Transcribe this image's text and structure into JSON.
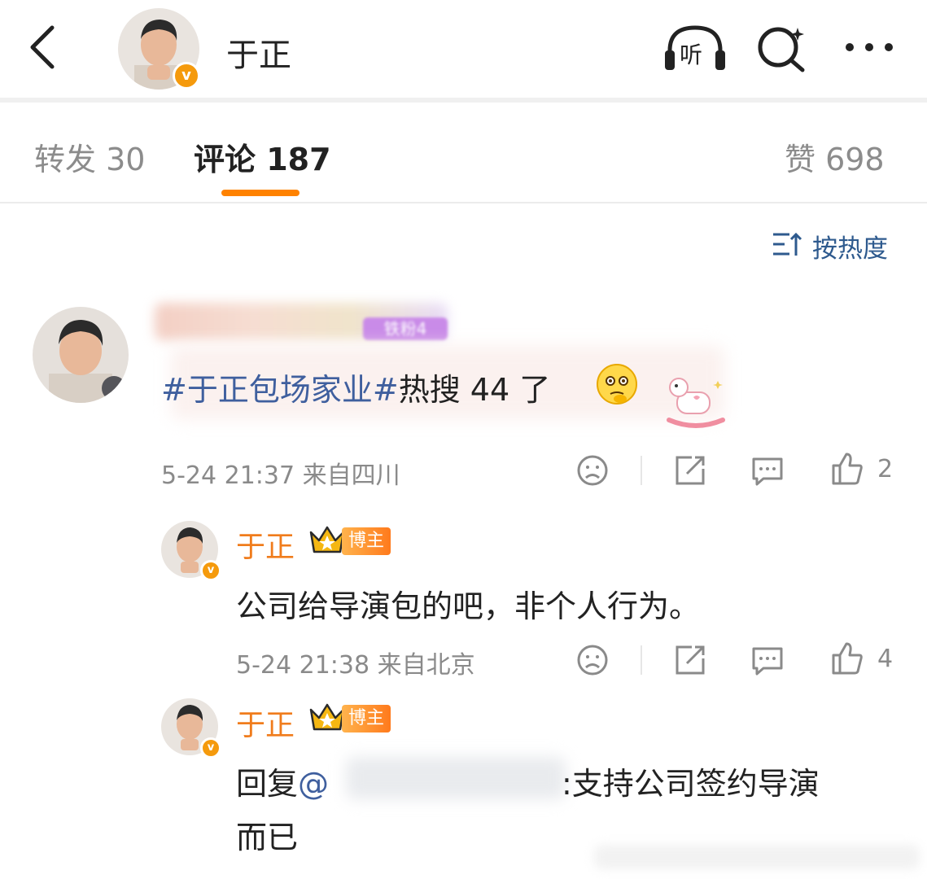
{
  "header": {
    "title": "于正",
    "listen_label": "听"
  },
  "tabs": {
    "repost": "转发 30",
    "comments": "评论 187",
    "likes": "赞 698"
  },
  "sort": {
    "label": "按热度"
  },
  "comment1": {
    "level_badge": "铁粉4",
    "text_topic": "#于正包场家业#",
    "text_rest": "热搜 44 了",
    "meta": "5-24 21:37 来自四川",
    "like_count": "2"
  },
  "reply1": {
    "author": "于正",
    "badge": "博主",
    "text": "公司给导演包的吧，非个人行为。",
    "meta": "5-24 21:38 来自北京",
    "like_count": "4"
  },
  "reply2": {
    "author": "于正",
    "badge": "博主",
    "reply_prefix": "回复",
    "mention": "@",
    "text_line1": ":支持公司签约导演",
    "text_line2": "而已"
  },
  "colors": {
    "accent": "#ff8200",
    "topic": "#3f5f9e",
    "author": "#f07c1c",
    "meta": "#8a8a8a"
  }
}
